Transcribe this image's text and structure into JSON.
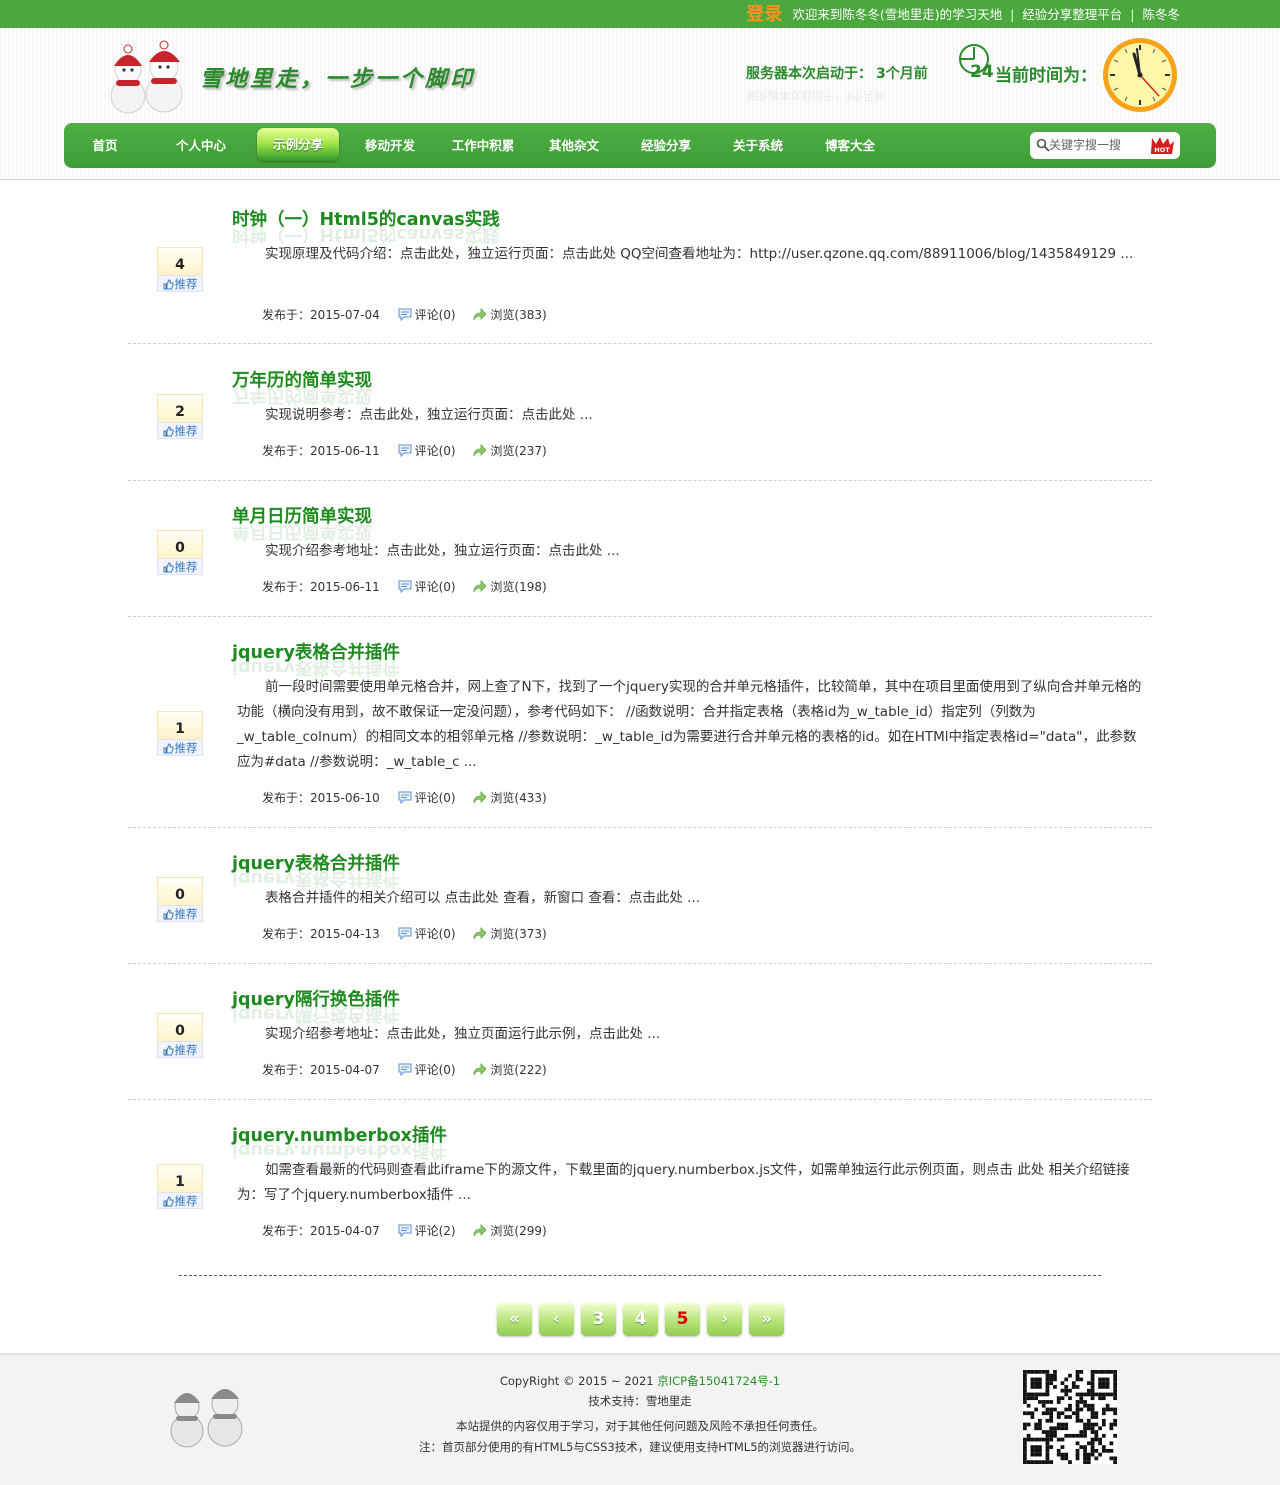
{
  "topbar": {
    "login": "登录",
    "welcome": "欢迎来到陈冬冬(雪地里走)的学习天地",
    "links": [
      "经验分享整理平台",
      "陈冬冬"
    ],
    "separator": "|"
  },
  "header": {
    "slogan": "雪地里走，一步一个脚印",
    "server_label": "服务器本次启动于：",
    "server_value": "3个月前",
    "hour_value": "24",
    "time_label": "当前时间为："
  },
  "nav": {
    "items": [
      "首页",
      "个人中心",
      "示例分享",
      "移动开发",
      "工作中积累",
      "其他杂文",
      "经验分享",
      "关于系统",
      "博客大全"
    ],
    "active": "示例分享"
  },
  "search": {
    "placeholder": "关键字搜一搜",
    "hot_label": "HOT"
  },
  "articles": [
    {
      "recommend": "4",
      "recommend_label": "推荐",
      "title": "时钟（一）Html5的canvas实践",
      "summary": "实现原理及代码介绍：点击此处，独立运行页面：点击此处 QQ空间查看地址为：http://user.qzone.qq.com/88911006/blog/1435849129 ...",
      "date": "发布于：2015-07-04",
      "comments": "评论(0)",
      "views": "浏览(383)"
    },
    {
      "recommend": "2",
      "recommend_label": "推荐",
      "title": "万年历的简单实现",
      "summary": "实现说明参考：点击此处，独立运行页面：点击此处 ...",
      "date": "发布于：2015-06-11",
      "comments": "评论(0)",
      "views": "浏览(237)"
    },
    {
      "recommend": "0",
      "recommend_label": "推荐",
      "title": "单月日历简单实现",
      "summary": "实现介绍参考地址：点击此处，独立运行页面：点击此处 ...",
      "date": "发布于：2015-06-11",
      "comments": "评论(0)",
      "views": "浏览(198)"
    },
    {
      "recommend": "1",
      "recommend_label": "推荐",
      "title": "jquery表格合并插件",
      "summary": "前一段时间需要使用单元格合并，网上查了N下，找到了一个jquery实现的合并单元格插件，比较简单，其中在项目里面使用到了纵向合并单元格的功能（横向没有用到，故不敢保证一定没问题），参考代码如下： //函数说明：合并指定表格（表格id为_w_table_id）指定列（列数为_w_table_colnum）的相同文本的相邻单元格 //参数说明：_w_table_id为需要进行合并单元格的表格的id。如在HTMl中指定表格id=\"data\"，此参数应为#data //参数说明：_w_table_c ...",
      "date": "发布于：2015-06-10",
      "comments": "评论(0)",
      "views": "浏览(433)"
    },
    {
      "recommend": "0",
      "recommend_label": "推荐",
      "title": "jquery表格合并插件",
      "summary": "表格合并插件的相关介绍可以 点击此处 查看，新窗口 查看：点击此处 ...",
      "date": "发布于：2015-04-13",
      "comments": "评论(0)",
      "views": "浏览(373)"
    },
    {
      "recommend": "0",
      "recommend_label": "推荐",
      "title": "jquery隔行换色插件",
      "summary": "实现介绍参考地址：点击此处，独立页面运行此示例，点击此处 ...",
      "date": "发布于：2015-04-07",
      "comments": "评论(0)",
      "views": "浏览(222)"
    },
    {
      "recommend": "1",
      "recommend_label": "推荐",
      "title": "jquery.numberbox插件",
      "summary": "如需查看最新的代码则查看此iframe下的源文件，下载里面的jquery.numberbox.js文件，如需单独运行此示例页面，则点击 此处 相关介绍链接为：写了个jquery.numberbox插件 ...",
      "date": "发布于：2015-04-07",
      "comments": "评论(2)",
      "views": "浏览(299)"
    }
  ],
  "pager": {
    "first": "«",
    "prev": "‹",
    "pages": [
      "3",
      "4",
      "5"
    ],
    "current": "5",
    "next": "›",
    "last": "»"
  },
  "footer": {
    "copyright": "CopyRight © 2015 ~ 2021",
    "icp": "京ICP备15041724号-1",
    "support": "技术支持：雪地里走",
    "disclaimer": "本站提供的内容仅用于学习，对于其他任何问题及风险不承担任何责任。",
    "note": "注：首页部分使用的有HTML5与CSS3技术，建议使用支持HTML5的浏览器进行访问。"
  },
  "colors": {
    "brand_green": "#4aa83d",
    "title_green": "#1f8a1f",
    "login_orange": "#f7941d",
    "current_page_red": "#e00000"
  }
}
